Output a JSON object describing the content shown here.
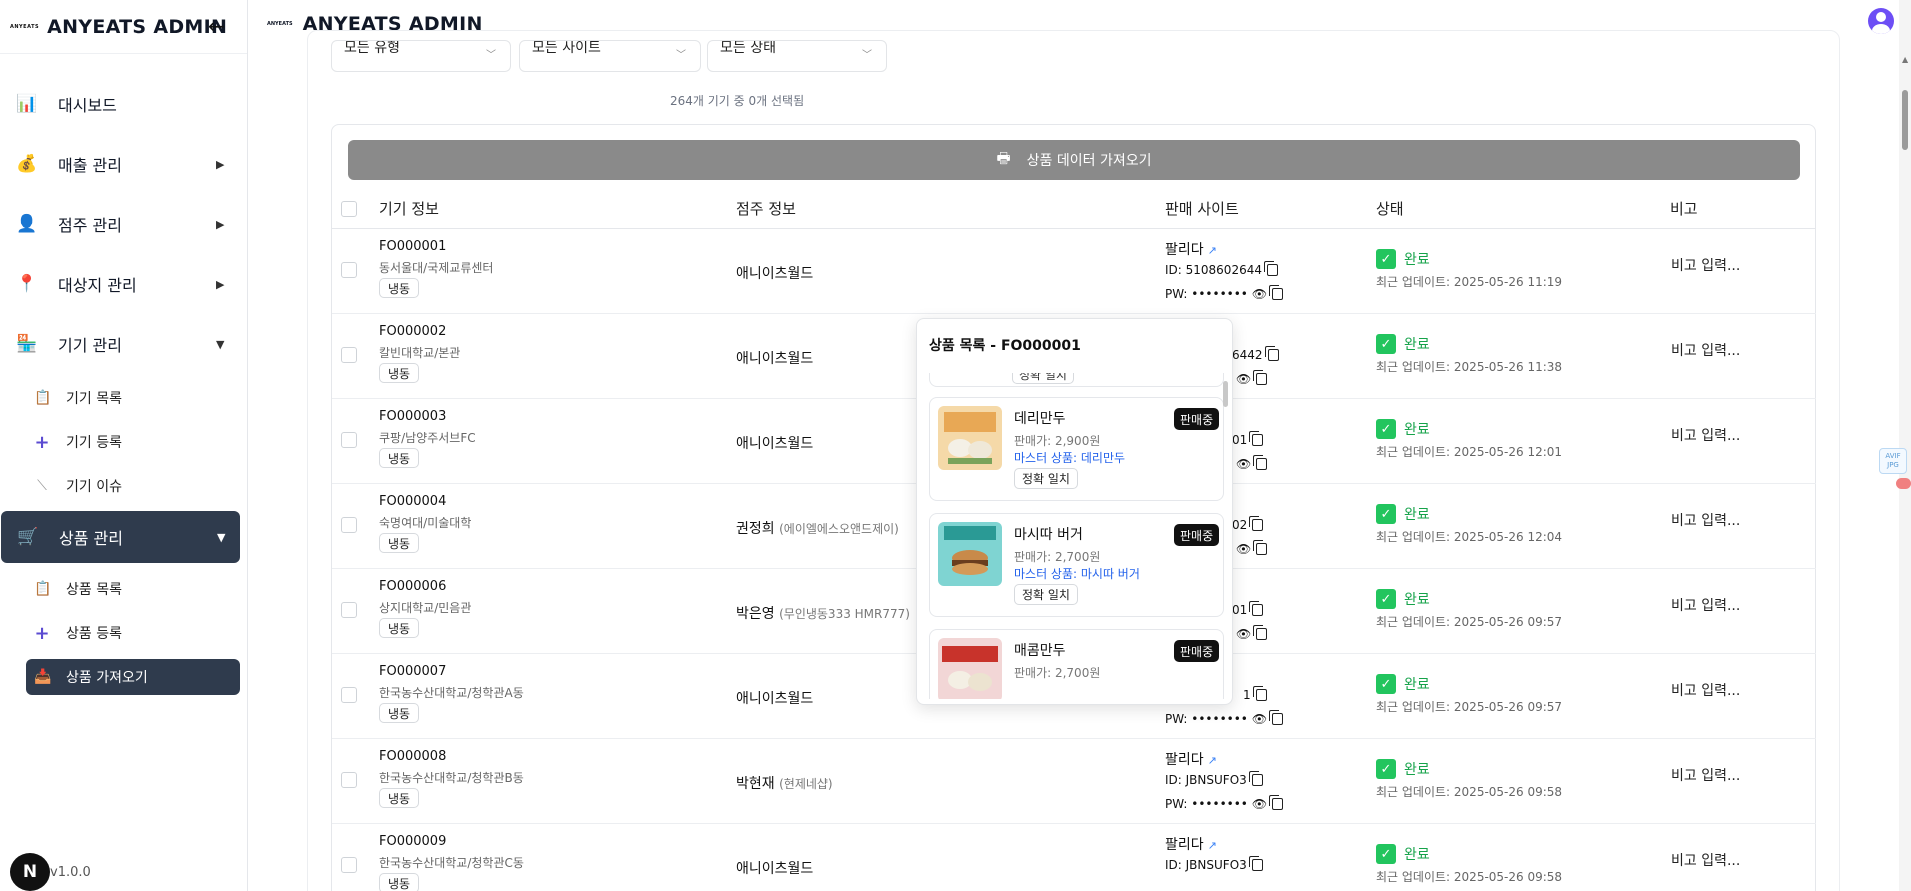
{
  "sidebar": {
    "logo_small": "ANYEATS",
    "title": "ANYEATS ADMIN",
    "back_icon": "arrow-left-icon",
    "items": [
      {
        "label": "대시보드",
        "icon": "chart-icon"
      },
      {
        "label": "매출 관리",
        "icon": "money-bag-icon"
      },
      {
        "label": "점주 관리",
        "icon": "person-icon"
      },
      {
        "label": "대상지 관리",
        "icon": "pin-icon"
      },
      {
        "label": "기기 관리",
        "icon": "store-icon"
      },
      {
        "label": "상품 관리",
        "icon": "cart-icon"
      }
    ],
    "device_sub": [
      {
        "label": "기기 목록",
        "icon": "clipboard-icon"
      },
      {
        "label": "기기 등록",
        "icon": "plus-icon"
      },
      {
        "label": "기기 이슈",
        "icon": "wrench-icon"
      }
    ],
    "product_sub": [
      {
        "label": "상품 목록",
        "icon": "clipboard-icon"
      },
      {
        "label": "상품 등록",
        "icon": "plus-icon"
      },
      {
        "label": "상품 가져오기",
        "icon": "box-icon"
      }
    ],
    "version": "v1.0.0",
    "n_badge": "N"
  },
  "topbar": {
    "logo_small": "ANYEATS",
    "title": "ANYEATS ADMIN"
  },
  "filters": {
    "type": "모든 유형",
    "site": "모든 사이트",
    "status": "모든 상태"
  },
  "selected_count": "264개 기기 중 0개 선택됨",
  "import_button": "상품 데이터 가져오기",
  "table": {
    "headers": [
      "기기 정보",
      "점주 정보",
      "판매 사이트",
      "상태",
      "비고"
    ],
    "rows": [
      {
        "code": "FO000001",
        "location": "동서울대/국제교류센터",
        "tag": "냉동",
        "owner": "애니이츠월드",
        "owner_sub": "",
        "site": "팔리다",
        "site_id": "ID: 5108602644",
        "pw": "PW: ••••••••",
        "status": "완료",
        "updated": "최근 업데이트: 2025-05-26 11:19",
        "memo": "비고 입력..."
      },
      {
        "code": "FO000002",
        "location": "칼빈대학교/본관",
        "tag": "냉동",
        "owner": "애니이츠월드",
        "owner_sub": "",
        "site": "",
        "site_id": "6442",
        "pw": "",
        "status": "완료",
        "updated": "최근 업데이트: 2025-05-26 11:38",
        "memo": "비고 입력..."
      },
      {
        "code": "FO000003",
        "location": "쿠팡/남양주서브FC",
        "tag": "냉동",
        "owner": "애니이츠월드",
        "owner_sub": "",
        "site": "",
        "site_id": "01",
        "pw": "",
        "status": "완료",
        "updated": "최근 업데이트: 2025-05-26 12:01",
        "memo": "비고 입력..."
      },
      {
        "code": "FO000004",
        "location": "숙명여대/미술대학",
        "tag": "냉동",
        "owner": "권정희",
        "owner_sub": "(에이엘에스오앤드제이)",
        "site": "",
        "site_id": "02",
        "pw": "",
        "status": "완료",
        "updated": "최근 업데이트: 2025-05-26 12:04",
        "memo": "비고 입력..."
      },
      {
        "code": "FO000006",
        "location": "상지대학교/민음관",
        "tag": "냉동",
        "owner": "박은영",
        "owner_sub": "(무인냉동333 HMR777)",
        "site": "",
        "site_id": "01",
        "pw": "",
        "status": "완료",
        "updated": "최근 업데이트: 2025-05-26 09:57",
        "memo": "비고 입력..."
      },
      {
        "code": "FO000007",
        "location": "한국농수산대학교/청학관A동",
        "tag": "냉동",
        "owner": "애니이츠월드",
        "owner_sub": "",
        "site": "",
        "site_id": "1",
        "pw": "PW: ••••••••",
        "status": "완료",
        "updated": "최근 업데이트: 2025-05-26 09:57",
        "memo": "비고 입력..."
      },
      {
        "code": "FO000008",
        "location": "한국농수산대학교/청학관B동",
        "tag": "냉동",
        "owner": "박현재",
        "owner_sub": "(현제네샵)",
        "site": "팔리다",
        "site_id": "ID: JBNSUFO3",
        "pw": "PW: ••••••••",
        "status": "완료",
        "updated": "최근 업데이트: 2025-05-26 09:58",
        "memo": "비고 입력..."
      },
      {
        "code": "FO000009",
        "location": "한국농수산대학교/청학관C동",
        "tag": "냉동",
        "owner": "애니이츠월드",
        "owner_sub": "",
        "site": "팔리다",
        "site_id": "ID: JBNSUFO3",
        "pw": "",
        "status": "완료",
        "updated": "최근 업데이트: 2025-05-26 09:58",
        "memo": "비고 입력..."
      }
    ]
  },
  "popover": {
    "title": "상품 목록 - FO000001",
    "clipped_tag": "정확 일치",
    "products": [
      {
        "name": "데리만두",
        "price": "판매가: 2,900원",
        "master": "마스터 상품: 데리만두",
        "match": "정확 일치",
        "badge": "판매중",
        "colors": [
          "#f5d9a8",
          "#e8a855",
          "#f4f0e6"
        ]
      },
      {
        "name": "마시따 버거",
        "price": "판매가: 2,700원",
        "master": "마스터 상품: 마시따 버거",
        "match": "정확 일치",
        "badge": "판매중",
        "colors": [
          "#7fd4d2",
          "#2a9a95",
          "#c88a4a"
        ]
      },
      {
        "name": "매콤만두",
        "price": "판매가: 2,700원",
        "master": "",
        "match": "",
        "badge": "판매중",
        "colors": [
          "#f2d6d6",
          "#c8332b",
          "#f4efe4"
        ]
      }
    ]
  },
  "widgets": {
    "avif_label": "AVIF JPG"
  },
  "colors": {
    "sidebar_active": "#2f3b4d",
    "status_green": "#22c55e",
    "import_button": "#8a8a8a",
    "avatar": "#6d4ef5"
  }
}
